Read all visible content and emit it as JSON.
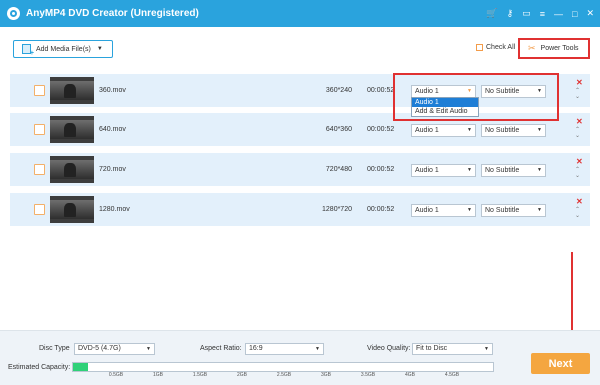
{
  "window": {
    "title": "AnyMP4 DVD Creator (Unregistered)",
    "icons": [
      "cart-icon",
      "key-icon",
      "chat-icon",
      "menu-icon",
      "minimize-icon",
      "maximize-icon",
      "close-icon"
    ],
    "icon_glyphs": [
      "🛒",
      "⚷",
      "▭",
      "≡",
      "—",
      "□",
      "✕"
    ]
  },
  "toolbar": {
    "add_media_label": "Add Media File(s)",
    "check_all_label": "Check All",
    "power_tools_label": "Power Tools"
  },
  "files": [
    {
      "name": "360.mov",
      "resolution": "360*240",
      "duration": "00:00:52",
      "audio": "Audio 1",
      "subtitle": "No Subtitle"
    },
    {
      "name": "640.mov",
      "resolution": "640*360",
      "duration": "00:00:52",
      "audio": "Audio 1",
      "subtitle": "No Subtitle"
    },
    {
      "name": "720.mov",
      "resolution": "720*480",
      "duration": "00:00:52",
      "audio": "Audio 1",
      "subtitle": "No Subtitle"
    },
    {
      "name": "1280.mov",
      "resolution": "1280*720",
      "duration": "00:00:52",
      "audio": "Audio 1",
      "subtitle": "No Subtitle"
    }
  ],
  "audio_dropdown": {
    "options": [
      "Audio 1",
      "Add & Edit Audio"
    ],
    "selected": "Audio 1"
  },
  "bottom": {
    "disc_type_label": "Disc Type",
    "disc_type_value": "DVD-5 (4.7G)",
    "aspect_ratio_label": "Aspect Ratio:",
    "aspect_ratio_value": "16:9",
    "video_quality_label": "Video Quality:",
    "video_quality_value": "Fit to Disc",
    "estimated_capacity_label": "Estimated Capacity:",
    "capacity_fraction": 0.035,
    "capacity_ticks": [
      "0.5GB",
      "1GB",
      "1.5GB",
      "2GB",
      "2.5GB",
      "3GB",
      "3.5GB",
      "4GB",
      "4.5GB"
    ],
    "next_label": "Next"
  },
  "colors": {
    "accent": "#2aa3dd",
    "highlight": "#e03131",
    "next": "#f4a640",
    "capacity_fill": "#2fd178"
  }
}
